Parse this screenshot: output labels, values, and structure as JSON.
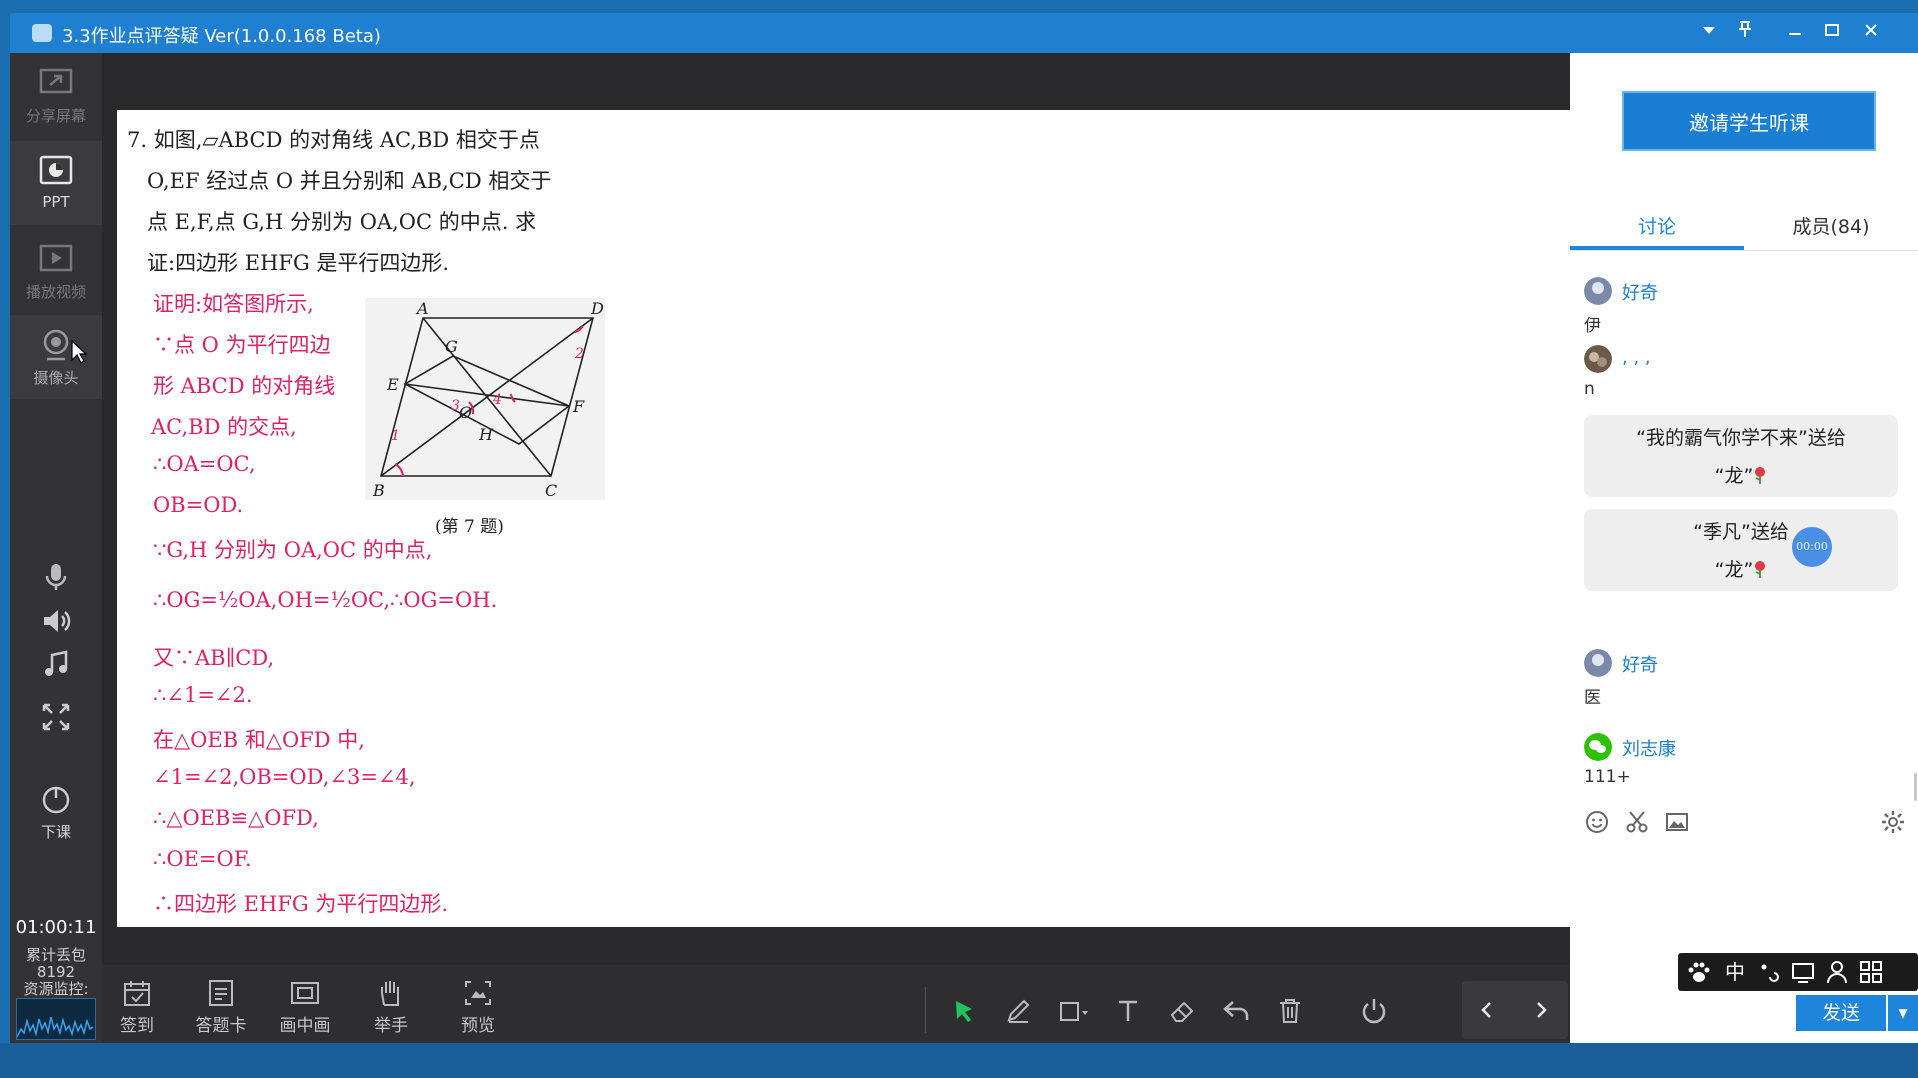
{
  "window": {
    "title": "3.3作业点评答疑 Ver(1.0.0.168 Beta)"
  },
  "rail": {
    "items": [
      {
        "label": "分享屏幕"
      },
      {
        "label": "PPT"
      },
      {
        "label": "播放视频"
      },
      {
        "label": "摄像头"
      },
      {
        "label": "下课"
      }
    ],
    "timer": "01:00:11",
    "packet_loss_label": "累计丢包",
    "packet_loss_value": "8192",
    "monitor_label": "资源监控:"
  },
  "doc": {
    "question": [
      "7. 如图,▱ABCD 的对角线 AC,BD 相交于点",
      "O,EF 经过点 O 并且分别和 AB,CD 相交于",
      "点 E,F,点 G,H 分别为 OA,OC 的中点. 求",
      "证:四边形 EHFG 是平行四边形."
    ],
    "proof_side": [
      "证明:如答图所示,",
      "∵点 O 为平行四边",
      "形 ABCD 的对角线",
      "AC,BD 的交点,",
      "∴OA=OC,",
      "OB=OD."
    ],
    "proof_main": [
      "∵G,H 分别为 OA,OC 的中点,",
      "∴OG=½OA,OH=½OC,∴OG=OH.",
      "又∵AB∥CD,",
      "∴∠1=∠2.",
      "在△OEB 和△OFD 中,",
      "∠1=∠2,OB=OD,∠3=∠4,",
      "∴△OEB≌△OFD,",
      "∴OE=OF.",
      "∴四边形 EHFG 为平行四边形."
    ],
    "figure_caption": "(第 7 题)",
    "figure_labels": {
      "A": "A",
      "B": "B",
      "C": "C",
      "D": "D",
      "E": "E",
      "F": "F",
      "G": "G",
      "H": "H",
      "O": "O",
      "n1": "1",
      "n2": "2",
      "n3": "3",
      "n4": "4"
    }
  },
  "toolbar": {
    "buttons": [
      {
        "label": "签到"
      },
      {
        "label": "答题卡"
      },
      {
        "label": "画中画"
      },
      {
        "label": "举手"
      },
      {
        "label": "预览"
      }
    ]
  },
  "panel": {
    "invite_label": "邀请学生听课",
    "tabs": [
      {
        "label": "讨论"
      },
      {
        "label": "成员(84)"
      }
    ],
    "messages": [
      {
        "name": "好奇",
        "text": "伊"
      },
      {
        "name": ", , ,",
        "text": "n"
      },
      {
        "name": "好奇",
        "text": "医"
      },
      {
        "name": "刘志康",
        "text": "111+"
      }
    ],
    "gifts": [
      {
        "line1": "“我的霸气你学不来”送给",
        "line2": "“龙”"
      },
      {
        "line1": "“季凡”送给",
        "line2": "“龙”"
      }
    ],
    "timer_badge": "00:00",
    "ime": {
      "zh": "中"
    },
    "send_label": "发送"
  },
  "colors": {
    "accent": "#1f7fd1",
    "proof": "#e0206a",
    "active_tool": "#1fc45a"
  }
}
